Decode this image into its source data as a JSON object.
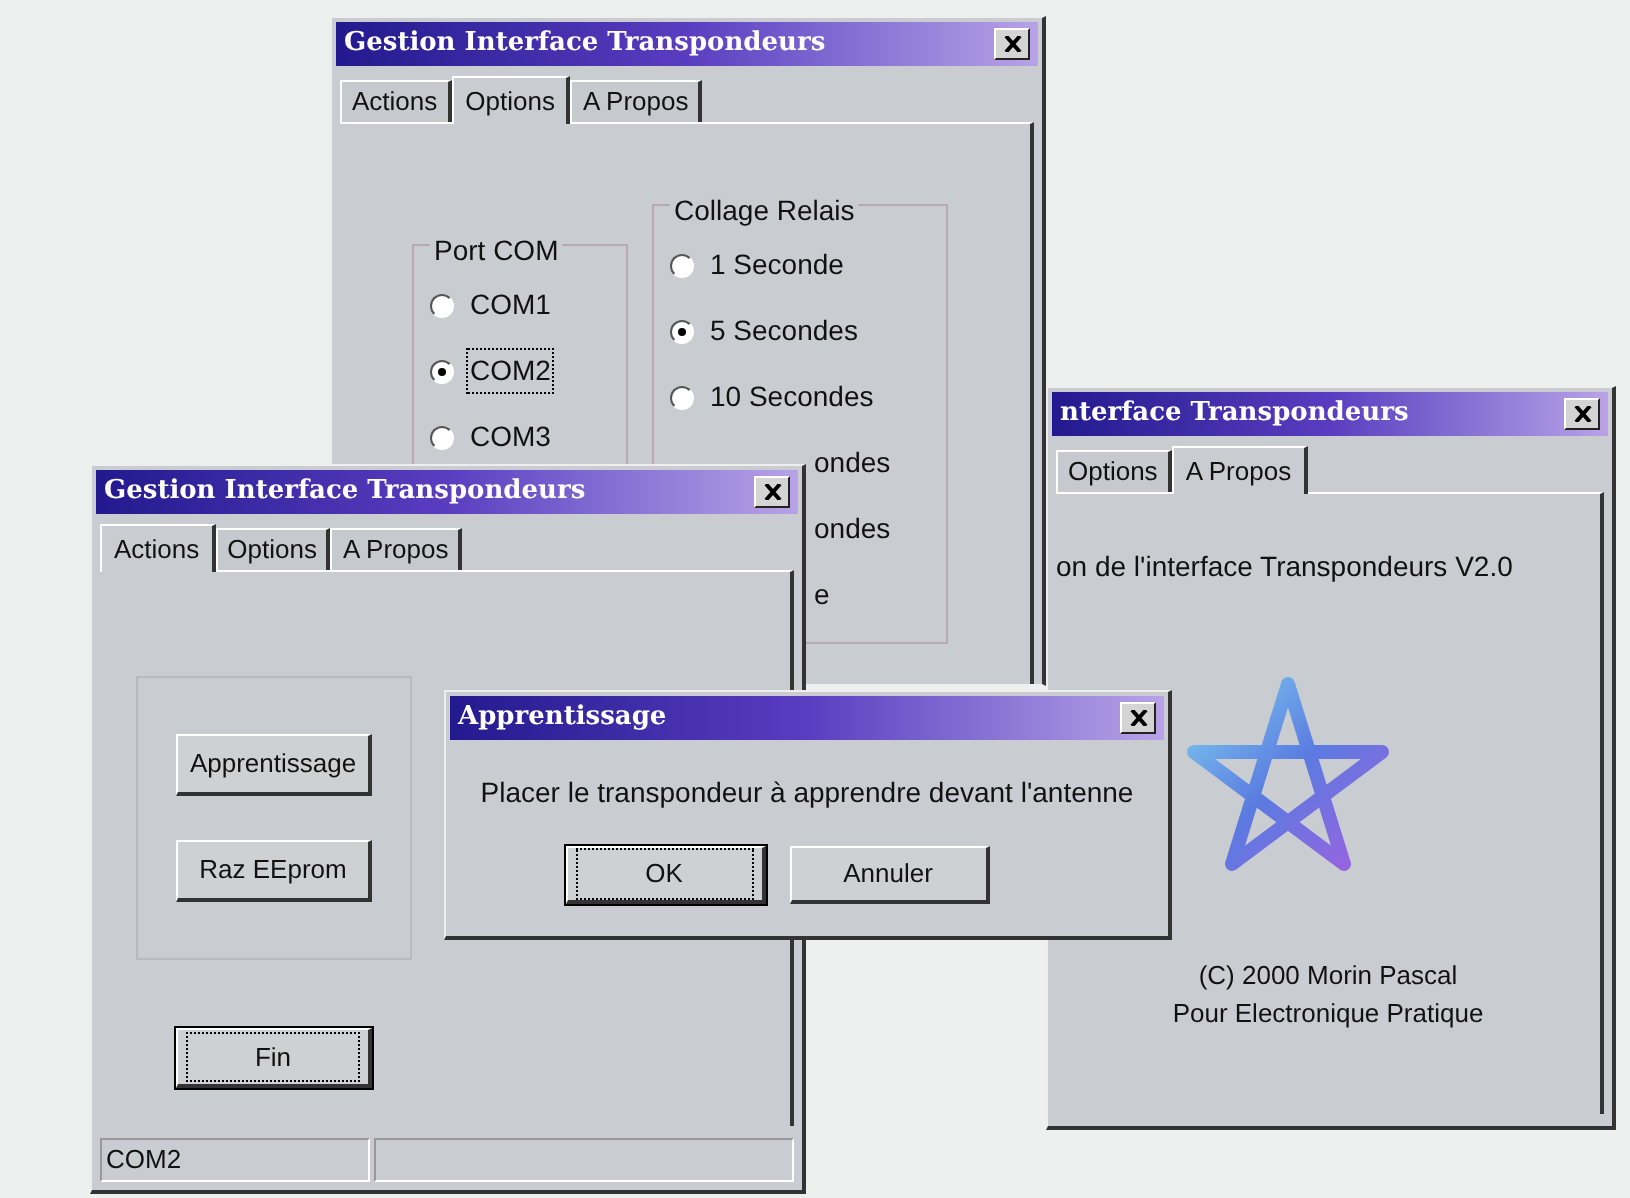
{
  "about_window": {
    "title": "nterface Transpondeurs",
    "tabs": [
      {
        "label": "Options",
        "selected": false
      },
      {
        "label": "A Propos",
        "selected": true
      }
    ],
    "version_text": "on de l'interface Transpondeurs V2.0",
    "credits": [
      "(C) 2000 Morin Pascal",
      "Pour Electronique Pratique"
    ]
  },
  "options_window": {
    "title": "Gestion Interface Transpondeurs",
    "tabs": [
      {
        "label": "Actions",
        "selected": false
      },
      {
        "label": "Options",
        "selected": true
      },
      {
        "label": "A Propos",
        "selected": false
      }
    ],
    "port_com": {
      "label": "Port COM",
      "options": [
        {
          "label": "COM1",
          "selected": false,
          "focused": false
        },
        {
          "label": "COM2",
          "selected": true,
          "focused": true
        },
        {
          "label": "COM3",
          "selected": false,
          "focused": false
        }
      ]
    },
    "collage_relais": {
      "label": "Collage Relais",
      "options": [
        {
          "label": "1 Seconde",
          "selected": false
        },
        {
          "label": "5 Secondes",
          "selected": true
        },
        {
          "label": "10 Secondes",
          "selected": false
        }
      ],
      "hidden_rows": [
        "ondes",
        "ondes",
        "e"
      ]
    }
  },
  "actions_window": {
    "title": "Gestion Interface Transpondeurs",
    "tabs": [
      {
        "label": "Actions",
        "selected": true
      },
      {
        "label": "Options",
        "selected": false
      },
      {
        "label": "A Propos",
        "selected": false
      }
    ],
    "buttons": [
      {
        "label": "Apprentissage",
        "focused": false
      },
      {
        "label": "Raz EEprom",
        "focused": false
      }
    ],
    "end_button": {
      "label": "Fin",
      "focused": true
    },
    "status_bar": {
      "text": "COM2"
    }
  },
  "dialog": {
    "title": "Apprentissage",
    "message": "Placer le transpondeur à apprendre devant l'antenne",
    "buttons": [
      {
        "label": "OK",
        "focused": true
      },
      {
        "label": "Annuler",
        "focused": false
      }
    ]
  }
}
